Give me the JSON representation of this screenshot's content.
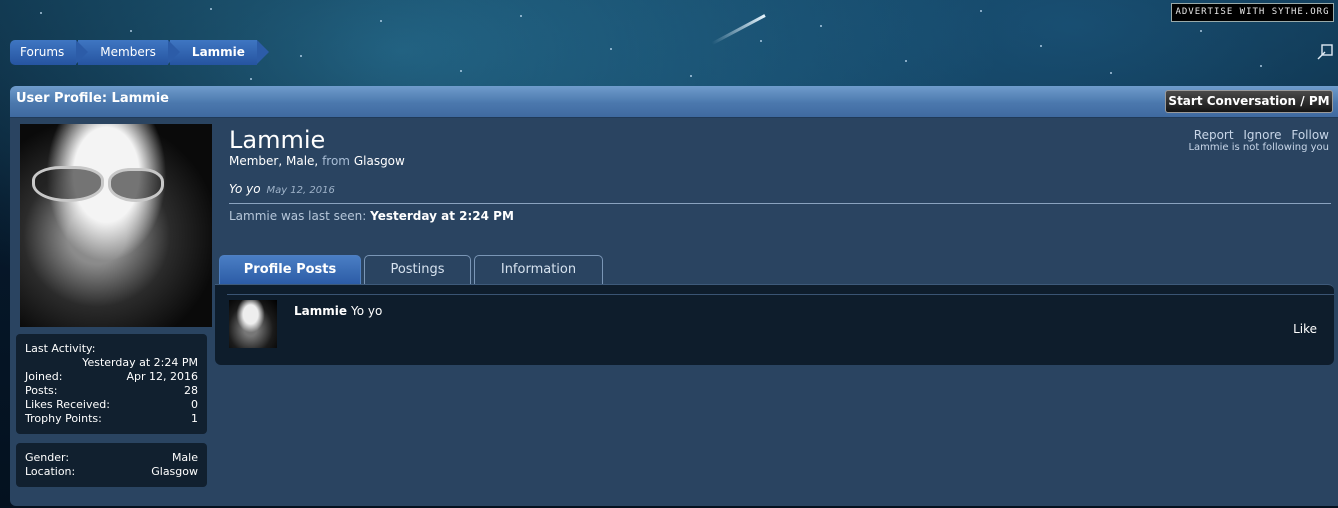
{
  "ad_badge": "Advertise with Sythe.org",
  "breadcrumb": [
    "Forums",
    "Members",
    "Lammie"
  ],
  "panel": {
    "title": "User Profile: Lammie",
    "start_button": "Start Conversation / PM"
  },
  "profile": {
    "username": "Lammie",
    "title_gender": "Member, Male,",
    "from_label": "from",
    "location": "Glasgow",
    "status_text": "Yo yo",
    "status_date": "May 12, 2016",
    "last_seen_label": "Lammie was last seen:",
    "last_seen_value": "Yesterday at 2:24 PM"
  },
  "actions": {
    "report": "Report",
    "ignore": "Ignore",
    "follow": "Follow",
    "follow_note": "Lammie is not following you"
  },
  "stats": {
    "last_activity_label": "Last Activity:",
    "last_activity_value": "Yesterday at 2:24 PM",
    "joined_label": "Joined:",
    "joined_value": "Apr 12, 2016",
    "posts_label": "Posts:",
    "posts_value": "28",
    "likes_label": "Likes Received:",
    "likes_value": "0",
    "trophy_label": "Trophy Points:",
    "trophy_value": "1"
  },
  "details": {
    "gender_label": "Gender:",
    "gender_value": "Male",
    "location_label": "Location:",
    "location_value": "Glasgow"
  },
  "tabs": [
    "Profile Posts",
    "Postings",
    "Information"
  ],
  "post": {
    "author": "Lammie",
    "text": "Yo yo",
    "like_label": "Like"
  },
  "colors": {
    "accent": "#2c5ca6",
    "panel_bg": "#2a4461",
    "dark_box": "#11202f"
  }
}
